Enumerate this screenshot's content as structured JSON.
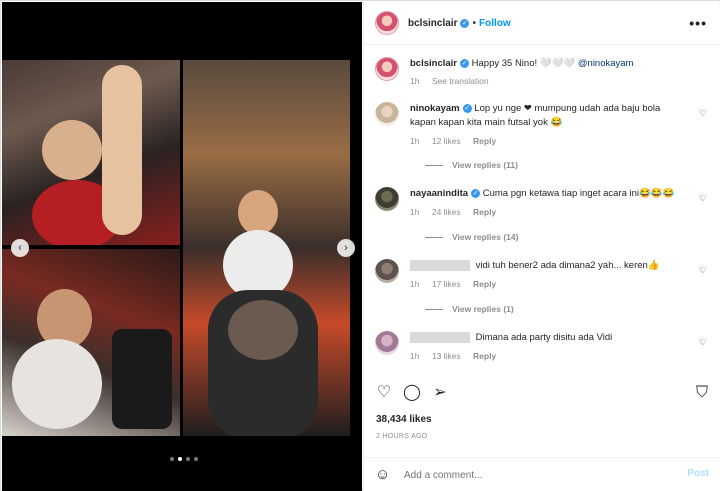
{
  "header": {
    "username": "bclsinclair",
    "separator": "•",
    "follow_label": "Follow",
    "more_label": "•••"
  },
  "caption": {
    "username": "bclsinclair",
    "text": "Happy 35 Nino! 🤍🤍🤍",
    "mention": "@ninokayam",
    "time": "1h",
    "translate": "See translation"
  },
  "comments": [
    {
      "username": "ninokayam",
      "verified": true,
      "text_line1": "Lop yu nge ❤ mumpung udah ada baju bola",
      "text_line2": "kapan kapan kita main futsal yok 😂",
      "time": "1h",
      "likes": "12 likes",
      "reply": "Reply",
      "view_replies": "View replies (11)"
    },
    {
      "username": "nayaanindita",
      "verified": true,
      "text_line1": "Cuma pgn ketawa tiap inget acara ini😂😂😂",
      "time": "1h",
      "likes": "24 likes",
      "reply": "Reply",
      "view_replies": "View replies (14)"
    },
    {
      "username": "",
      "text_line1": "vidi tuh bener2 ada dimana2 yah... keren👍",
      "time": "1h",
      "likes": "17 likes",
      "reply": "Reply",
      "view_replies": "View replies (1)"
    },
    {
      "username": "",
      "text_line1": "Dimana ada party disitu ada Vidi",
      "time": "1h",
      "likes": "13 likes",
      "reply": "Reply"
    }
  ],
  "actions": {
    "heart": "♡",
    "comment": "◯",
    "share": "➢",
    "save": "⛉"
  },
  "likes_count": "38,434 likes",
  "date": "2 HOURS AGO",
  "add_comment": {
    "placeholder": "Add a comment...",
    "post_label": "Post",
    "emoji": "☺"
  },
  "carousel": {
    "prev": "‹",
    "next": "›"
  }
}
